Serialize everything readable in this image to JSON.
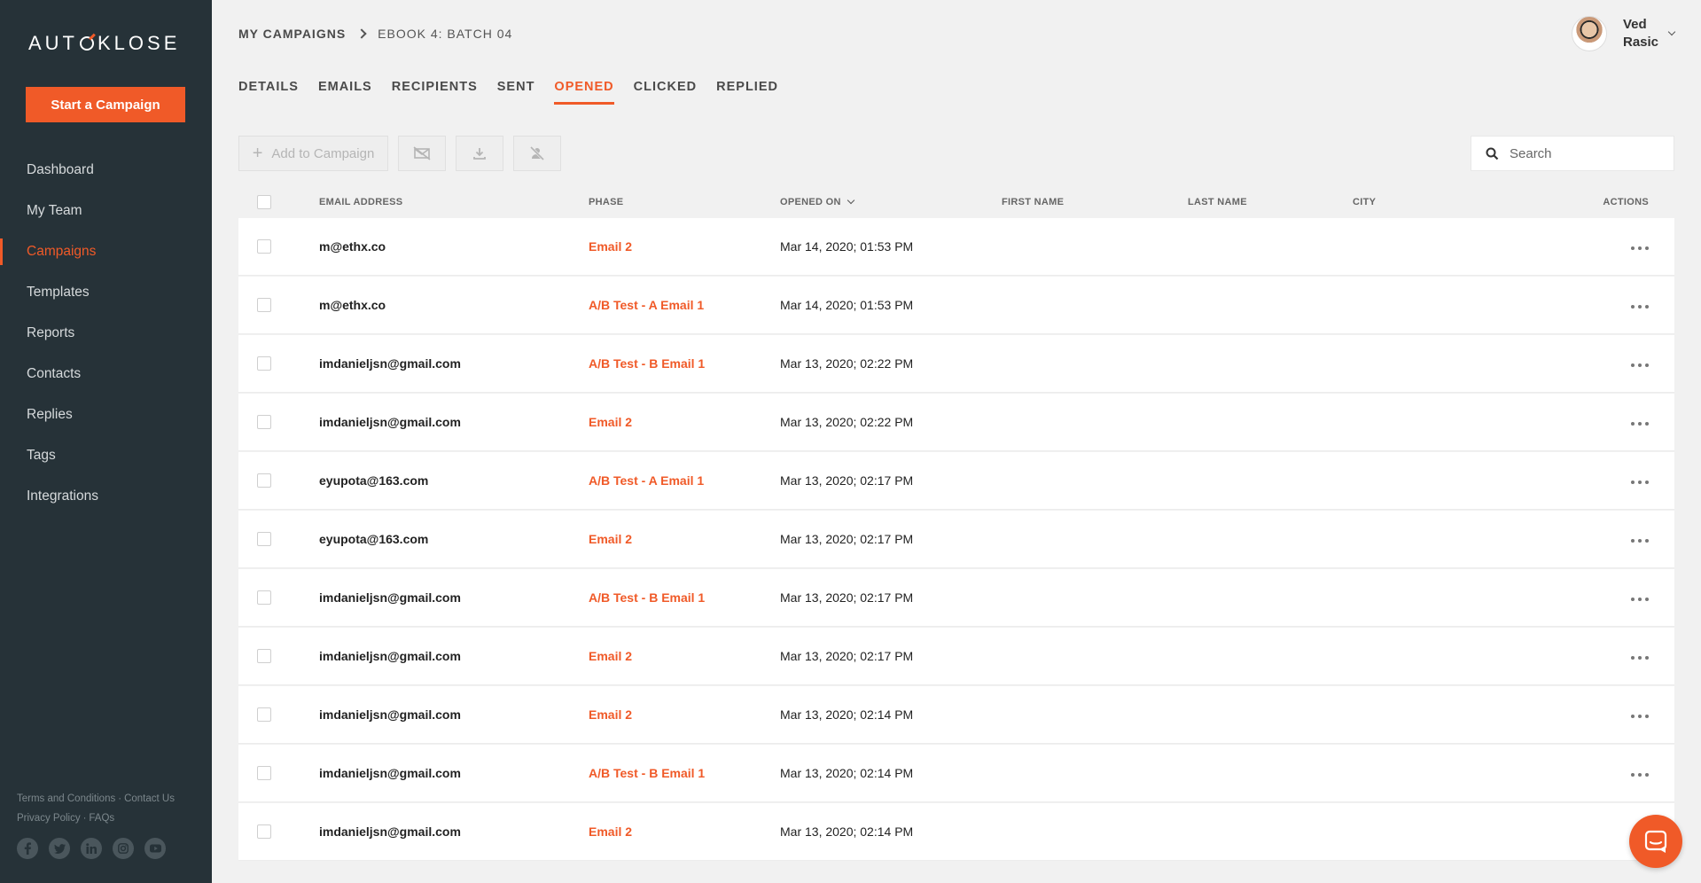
{
  "sidebar": {
    "logo_text": "AUT",
    "logo_text_2": "KLOSE",
    "start_button": "Start a Campaign",
    "items": [
      {
        "label": "Dashboard",
        "active": false
      },
      {
        "label": "My Team",
        "active": false
      },
      {
        "label": "Campaigns",
        "active": true
      },
      {
        "label": "Templates",
        "active": false
      },
      {
        "label": "Reports",
        "active": false
      },
      {
        "label": "Contacts",
        "active": false
      },
      {
        "label": "Replies",
        "active": false
      },
      {
        "label": "Tags",
        "active": false
      },
      {
        "label": "Integrations",
        "active": false
      }
    ],
    "footer": {
      "terms": "Terms and Conditions",
      "contact": "Contact Us",
      "privacy": "Privacy Policy",
      "faqs": "FAQs",
      "separator": "·"
    },
    "socials": [
      "facebook-icon",
      "twitter-icon",
      "linkedin-icon",
      "instagram-icon",
      "youtube-icon"
    ]
  },
  "header": {
    "breadcrumb_root": "MY CAMPAIGNS",
    "breadcrumb_current": "EBOOK 4: BATCH 04",
    "user_first": "Ved",
    "user_last": "Rasic"
  },
  "tabs": [
    "DETAILS",
    "EMAILS",
    "RECIPIENTS",
    "SENT",
    "OPENED",
    "CLICKED",
    "REPLIED"
  ],
  "active_tab": "OPENED",
  "toolbar": {
    "add_label": "Add to Campaign",
    "search_placeholder": "Search"
  },
  "table": {
    "columns": {
      "email": "EMAIL ADDRESS",
      "phase": "PHASE",
      "opened": "OPENED ON",
      "first": "FIRST NAME",
      "last": "LAST NAME",
      "city": "CITY",
      "actions": "ACTIONS"
    },
    "rows": [
      {
        "email": "m@ethx.co",
        "phase": "Email 2",
        "opened": "Mar 14, 2020; 01:53 PM"
      },
      {
        "email": "m@ethx.co",
        "phase": "A/B Test - A Email 1",
        "opened": "Mar 14, 2020; 01:53 PM"
      },
      {
        "email": "imdanieljsn@gmail.com",
        "phase": "A/B Test - B Email 1",
        "opened": "Mar 13, 2020; 02:22 PM"
      },
      {
        "email": "imdanieljsn@gmail.com",
        "phase": "Email 2",
        "opened": "Mar 13, 2020; 02:22 PM"
      },
      {
        "email": "eyupota@163.com",
        "phase": "A/B Test - A Email 1",
        "opened": "Mar 13, 2020; 02:17 PM"
      },
      {
        "email": "eyupota@163.com",
        "phase": "Email 2",
        "opened": "Mar 13, 2020; 02:17 PM"
      },
      {
        "email": "imdanieljsn@gmail.com",
        "phase": "A/B Test - B Email 1",
        "opened": "Mar 13, 2020; 02:17 PM"
      },
      {
        "email": "imdanieljsn@gmail.com",
        "phase": "Email 2",
        "opened": "Mar 13, 2020; 02:17 PM"
      },
      {
        "email": "imdanieljsn@gmail.com",
        "phase": "Email 2",
        "opened": "Mar 13, 2020; 02:14 PM"
      },
      {
        "email": "imdanieljsn@gmail.com",
        "phase": "A/B Test - B Email 1",
        "opened": "Mar 13, 2020; 02:14 PM"
      },
      {
        "email": "imdanieljsn@gmail.com",
        "phase": "Email 2",
        "opened": "Mar 13, 2020; 02:14 PM"
      }
    ]
  },
  "colors": {
    "accent": "#f05a28",
    "sidebar_bg": "#263238",
    "page_bg": "#f1f1f1"
  }
}
